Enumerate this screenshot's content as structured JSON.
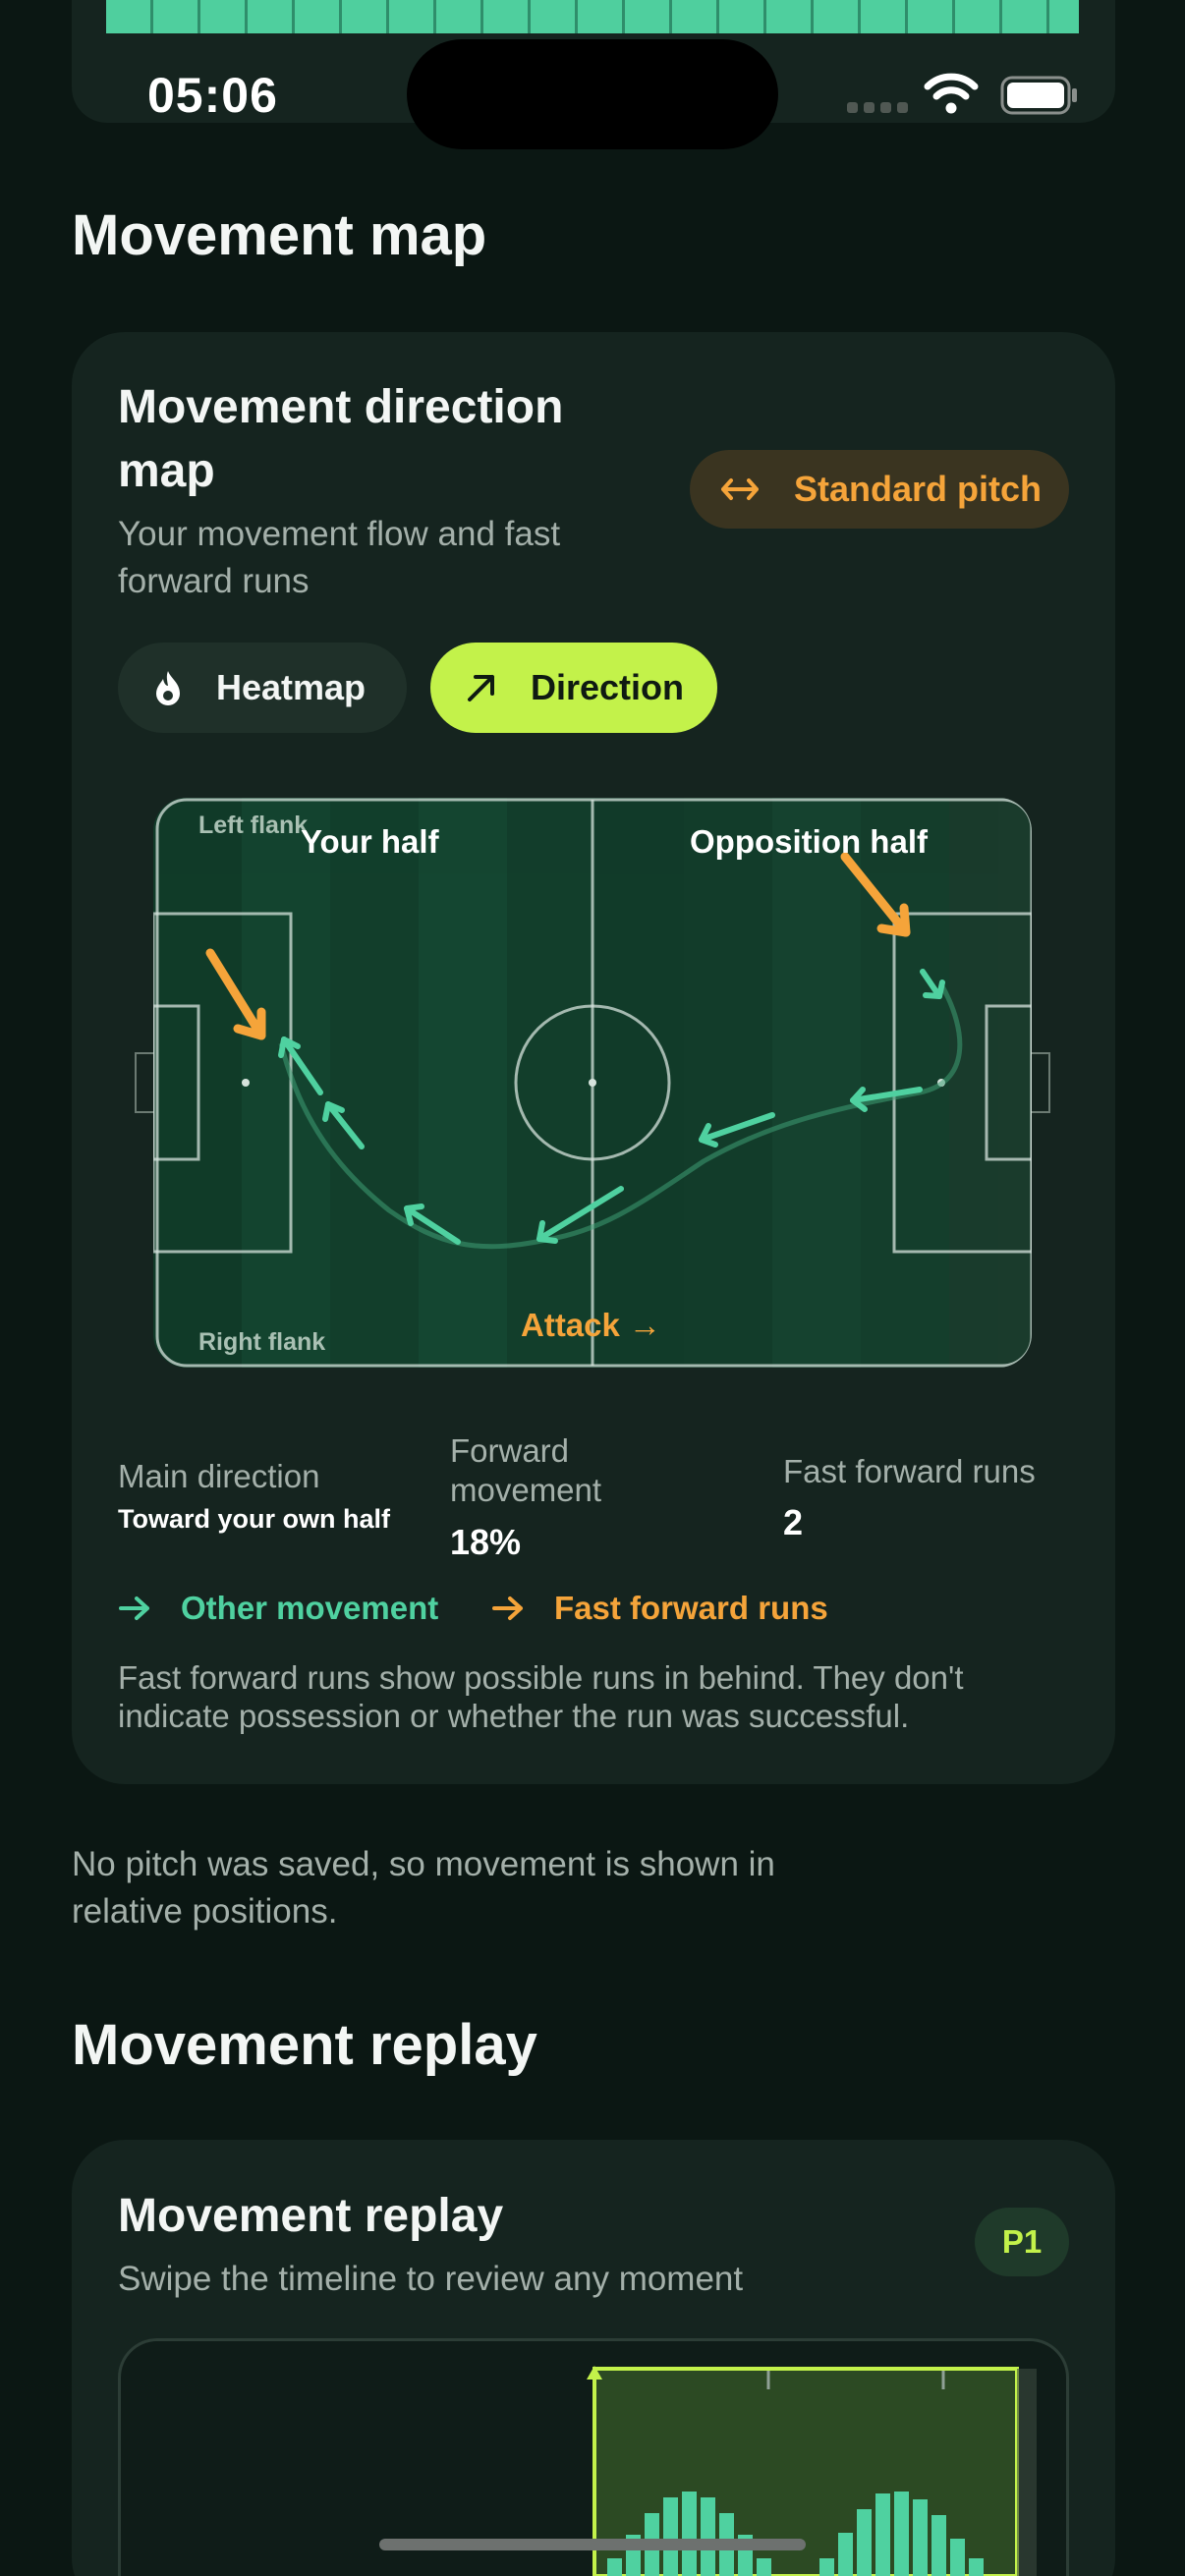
{
  "status_bar": {
    "time": "05:06"
  },
  "movement_map": {
    "section_title": "Movement map",
    "card": {
      "title": "Movement direction map",
      "subtitle": "Your movement flow and fast forward runs",
      "pitch_button": "Standard pitch",
      "tabs": [
        {
          "label": "Heatmap",
          "icon": "flame-icon",
          "selected": false
        },
        {
          "label": "Direction",
          "icon": "arrow-up-right-icon",
          "selected": true
        }
      ],
      "pitch": {
        "left_flank": "Left flank",
        "right_flank": "Right flank",
        "your_half": "Your half",
        "opposition_half": "Opposition half",
        "attack": "Attack →"
      },
      "stats": {
        "main_direction_label": "Main direction",
        "main_direction_value": "Toward your own half",
        "forward_movement_label": "Forward movement",
        "forward_movement_value": "18%",
        "fast_runs_label": "Fast forward runs",
        "fast_runs_value": "2"
      },
      "legend": {
        "other_movement": "Other movement",
        "fast_forward_runs": "Fast forward runs"
      },
      "note": "Fast forward runs show possible runs in behind. They don't indicate possession or whether the run was successful."
    },
    "footer_note": "No pitch was saved, so movement is shown in relative positions."
  },
  "movement_replay": {
    "section_title": "Movement replay",
    "card": {
      "title": "Movement replay",
      "subtitle": "Swipe the timeline to review any moment",
      "period_badge": "P1"
    }
  },
  "colors": {
    "accent_lime": "#c3f24a",
    "accent_orange": "#f5a43a",
    "accent_green": "#4fd1a0",
    "background": "#0b1713",
    "card": "#15241f"
  }
}
